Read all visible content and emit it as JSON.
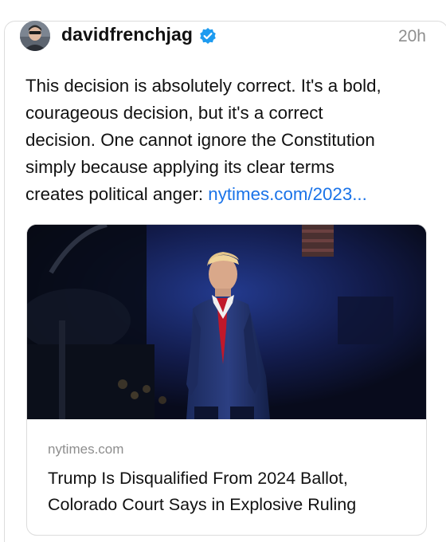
{
  "post": {
    "author": "davidfrenchjag",
    "verified": true,
    "timestamp": "20h",
    "text_lines": [
      "This decision is absolutely correct. It's a bold,",
      "courageous decision, but it's a correct",
      "decision. One cannot ignore the Constitution",
      "simply because applying its clear terms",
      "creates political anger: "
    ],
    "link_text": "nytimes.com/2023..."
  },
  "embed": {
    "source": "nytimes.com",
    "headline_lines": [
      "Trump Is Disqualified From 2024 Ballot,",
      "Colorado Court Says in Explosive Ruling"
    ],
    "image_subject": "man-in-navy-suit-with-red-tie-on-stage"
  },
  "colors": {
    "link": "#1a73e8",
    "verified_badge": "#1d9bf0",
    "muted_text": "#8e8e8e",
    "border": "#dcdcdc",
    "photo_background": "#0c1024"
  },
  "icons": {
    "verified": "verified-badge-icon"
  }
}
